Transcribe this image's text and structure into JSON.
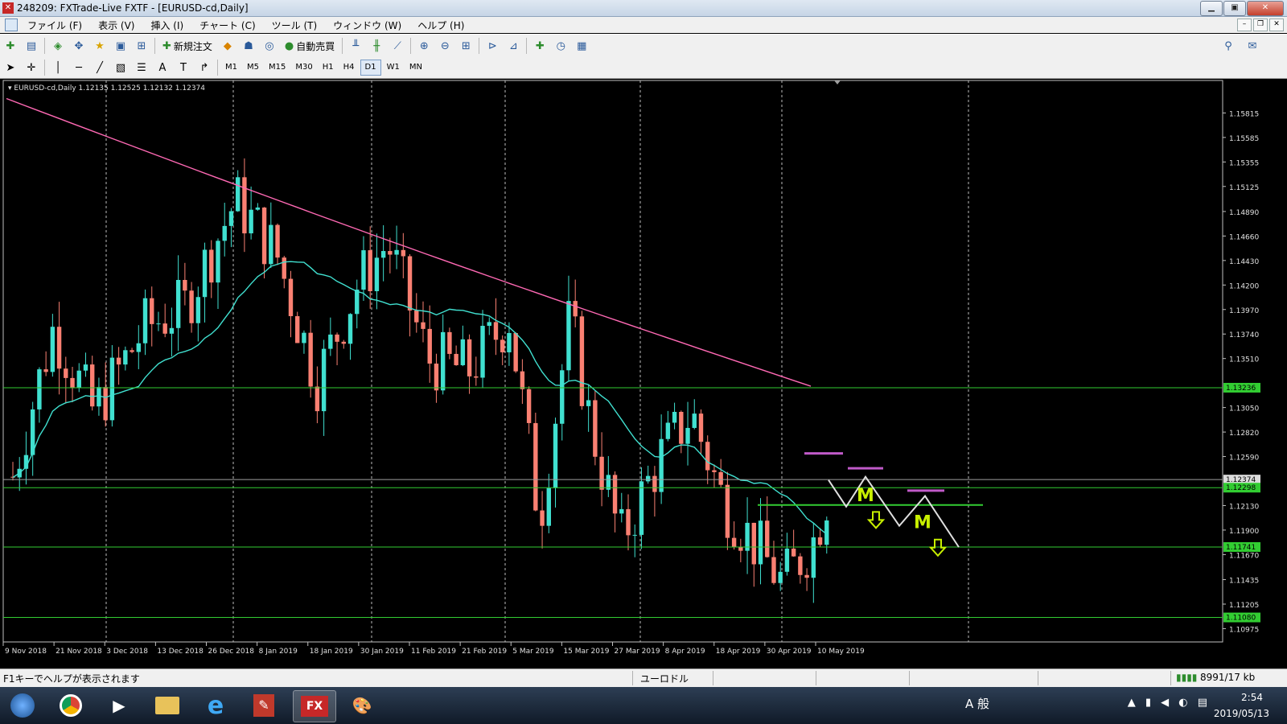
{
  "window": {
    "title": "248209: FXTrade-Live FXTF - [EURUSD-cd,Daily]",
    "minimize": "▁",
    "maximize": "▣",
    "close": "✕"
  },
  "menu": [
    "ファイル (F)",
    "表示 (V)",
    "挿入 (I)",
    "チャート (C)",
    "ツール (T)",
    "ウィンドウ (W)",
    "ヘルプ (H)"
  ],
  "toolbar": {
    "new_order": "新規注文",
    "auto_trade": "自動売買"
  },
  "timeframes": [
    "M1",
    "M5",
    "M15",
    "M30",
    "H1",
    "H4",
    "D1",
    "W1",
    "MN"
  ],
  "active_timeframe": "D1",
  "chart_info": "EURUSD-cd,Daily  1.12135 1.12525 1.12132 1.12374",
  "chart_data": {
    "type": "candlestick",
    "symbol": "EURUSD-cd",
    "timeframe": "Daily",
    "ohlc_last": {
      "open": 1.12135,
      "high": 1.12525,
      "low": 1.12132,
      "close": 1.12374
    },
    "y_range": [
      1.1085,
      1.1612
    ],
    "y_ticks": [
      "1.15815",
      "1.15585",
      "1.15355",
      "1.15125",
      "1.14890",
      "1.14660",
      "1.14430",
      "1.14200",
      "1.13970",
      "1.13740",
      "1.13510",
      "1.13050",
      "1.12820",
      "1.12590",
      "1.12130",
      "1.11900",
      "1.11670",
      "1.11435",
      "1.11205",
      "1.10975"
    ],
    "x_labels": [
      "9 Nov 2018",
      "21 Nov 2018",
      "3 Dec 2018",
      "13 Dec 2018",
      "26 Dec 2018",
      "8 Jan 2019",
      "18 Jan 2019",
      "30 Jan 2019",
      "11 Feb 2019",
      "21 Feb 2019",
      "5 Mar 2019",
      "15 Mar 2019",
      "27 Mar 2019",
      "8 Apr 2019",
      "18 Apr 2019",
      "30 Apr 2019",
      "10 May 2019"
    ],
    "price_labels": [
      {
        "value": 1.13236,
        "label": "1.13236",
        "kind": "line"
      },
      {
        "value": 1.12374,
        "label": "1.12374",
        "kind": "bid"
      },
      {
        "value": 1.12298,
        "label": "1.12298",
        "kind": "line"
      },
      {
        "value": 1.11741,
        "label": "1.11741",
        "kind": "line"
      },
      {
        "value": 1.1108,
        "label": "1.11080",
        "kind": "line"
      }
    ],
    "ma_fast_color": "#40e0d0",
    "ma_slow_color": "#ff69b4",
    "bull_color": "#40e0d0",
    "bear_color": "#fa8072",
    "line_color": "#32cd32",
    "annotation_text": [
      "M",
      "M"
    ],
    "annotation_color": "#c8f000"
  },
  "status": {
    "help": "F1キーでヘルプが表示されます",
    "currency": "ユーロドル",
    "traffic": "8991/17 kb"
  },
  "taskbar": {
    "time": "2:54",
    "date": "2019/05/13",
    "ime": "A 般"
  }
}
